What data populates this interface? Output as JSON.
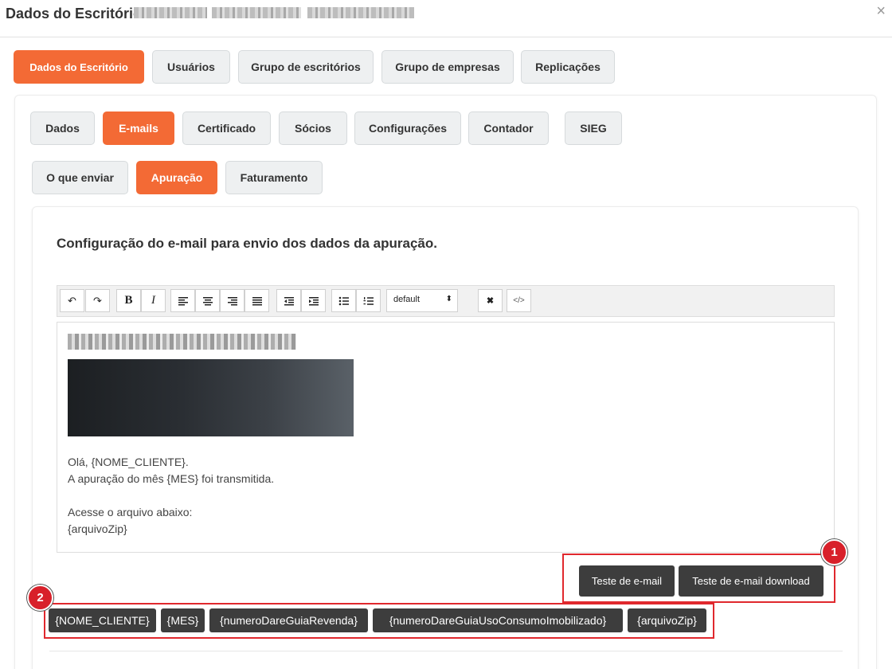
{
  "header": {
    "title": "Dados do Escritório",
    "close_icon": "×"
  },
  "main_tabs": [
    {
      "label": "Dados do Escritório",
      "active": true
    },
    {
      "label": "Usuários",
      "active": false
    },
    {
      "label": "Grupo de escritórios",
      "active": false
    },
    {
      "label": "Grupo de empresas",
      "active": false
    },
    {
      "label": "Replicações",
      "active": false
    }
  ],
  "sub_tabs": [
    {
      "label": "Dados",
      "active": false
    },
    {
      "label": "E-mails",
      "active": true
    },
    {
      "label": "Certificado",
      "active": false
    },
    {
      "label": "Sócios",
      "active": false
    },
    {
      "label": "Configurações",
      "active": false
    },
    {
      "label": "Contador",
      "active": false
    },
    {
      "label": "SIEG",
      "active": false
    }
  ],
  "email_tabs": [
    {
      "label": "O que enviar",
      "active": false
    },
    {
      "label": "Apuração",
      "active": true
    },
    {
      "label": "Faturamento",
      "active": false
    }
  ],
  "section_title": "Configuração do e-mail para envio dos dados da apuração.",
  "toolbar": {
    "undo_icon": "↶",
    "redo_icon": "↷",
    "bold_label": "B",
    "italic_label": "I",
    "font_select_value": "default",
    "clear_format_icon": "✖",
    "code_view_icon": "</>"
  },
  "editor": {
    "greeting": "Olá, {NOME_CLIENTE}.",
    "line2": "A apuração do mês {MES} foi transmitida.",
    "line3": "Acesse o arquivo abaixo:",
    "line4": "{arquivoZip}"
  },
  "actions": {
    "test_email": "Teste de e-mail",
    "test_email_download": "Teste de e-mail download"
  },
  "tags": [
    "{NOME_CLIENTE}",
    "{MES}",
    "{numeroDareGuiaRevenda}",
    "{numeroDareGuiaUsoConsumoImobilizado}",
    "{arquivoZip}"
  ],
  "markers": {
    "one": "1",
    "two": "2"
  },
  "colors": {
    "accent": "#f36a35",
    "dark_button": "#3d3d3d",
    "highlight": "#e0282d"
  }
}
